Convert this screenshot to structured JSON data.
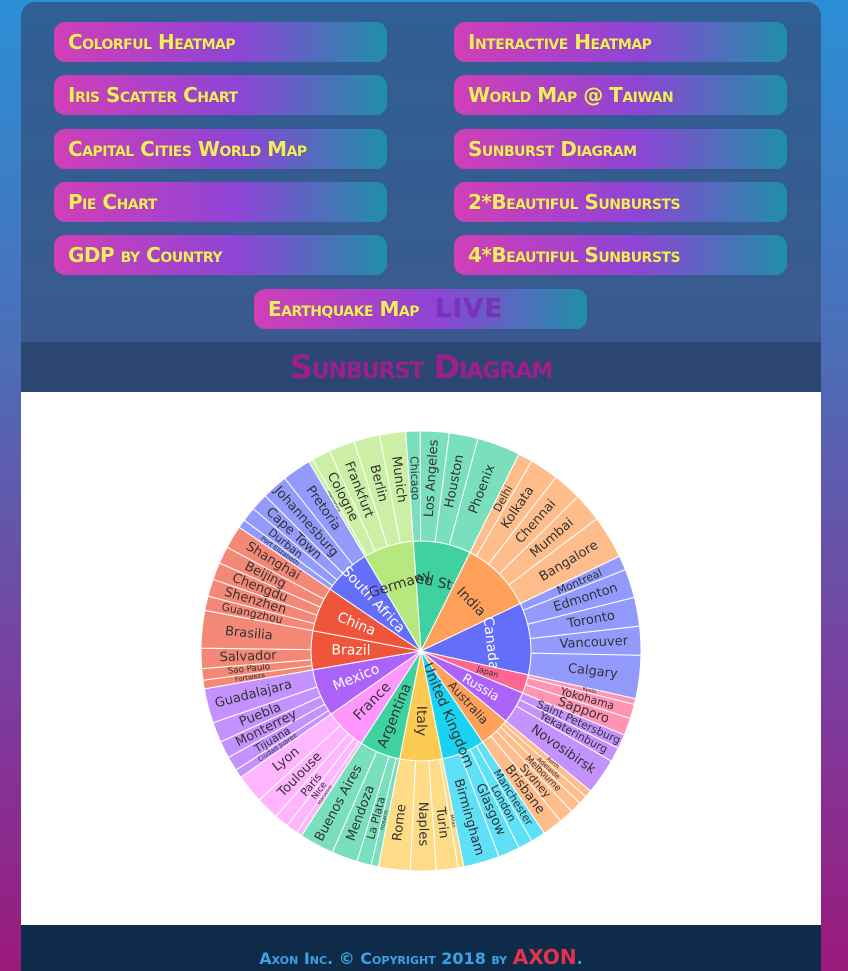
{
  "nav": [
    {
      "label": "Colorful Heatmap"
    },
    {
      "label": "Interactive Heatmap"
    },
    {
      "label": "Iris Scatter Chart"
    },
    {
      "label": "World Map @ Taiwan"
    },
    {
      "label": "Capital Cities World Map"
    },
    {
      "label": "Sunburst Diagram"
    },
    {
      "label": "Pie Chart"
    },
    {
      "label": "2*Beautiful Sunbursts"
    },
    {
      "label": "GDP by Country"
    },
    {
      "label": "4*Beautiful Sunbursts"
    }
  ],
  "earthquake": {
    "label": "Earthquake Map",
    "live": "LIVE"
  },
  "page_title": "Sunburst Diagram",
  "footer": {
    "text": "Axon Inc. © Copyright 2018 by ",
    "brand": "AXON",
    "end": "."
  },
  "chart_data": {
    "type": "sunburst",
    "countries": [
      {
        "name": "United States",
        "color": "#3fd1a0",
        "cities": [
          "Chicago",
          "Los Angeles",
          "Houston",
          "Phoenix"
        ],
        "w": [
          1,
          2,
          2,
          3
        ]
      },
      {
        "name": "India",
        "color": "#ffa15a",
        "cities": [
          "Delhi",
          "Kolkata",
          "Chennai",
          "Mumbai",
          "Bangalore"
        ],
        "w": [
          1,
          2,
          2,
          2,
          3
        ]
      },
      {
        "name": "Canada",
        "color": "#636efa",
        "cities": [
          "Montreal",
          "Edmonton",
          "Toronto",
          "Vancouver",
          "Calgary"
        ],
        "w": [
          1,
          2,
          2,
          2,
          3
        ]
      },
      {
        "name": "Japan",
        "color": "#ff6692",
        "cities": [
          "Kyoto",
          "Yokohama",
          "Sapporo"
        ],
        "w": [
          0.4,
          1,
          1.2
        ]
      },
      {
        "name": "Russia",
        "color": "#ab63fa",
        "cities": [
          "Saint Petersburg",
          "Yekaterinburg",
          "Novosibirsk"
        ],
        "w": [
          1,
          1,
          2.5
        ]
      },
      {
        "name": "Australia",
        "color": "#ffa15a",
        "cities": [
          "Perth",
          "Adelaide",
          "Melbourne",
          "Sydney",
          "Brisbane"
        ],
        "w": [
          0.5,
          0.6,
          0.8,
          1,
          1.4
        ]
      },
      {
        "name": "United Kingdom",
        "color": "#19d3f3",
        "cities": [
          "Manchester",
          "London",
          "Glasgow",
          "Birmingham"
        ],
        "w": [
          1,
          1,
          1.5,
          2.5
        ]
      },
      {
        "name": "Italy",
        "color": "#fecb52",
        "cities": [
          "Milan",
          "Turin",
          "Naples",
          "Rome"
        ],
        "w": [
          0.4,
          1.5,
          1.8,
          2.2
        ]
      },
      {
        "name": "Argentina",
        "color": "#3fd1a0",
        "cities": [
          "Rosario",
          "La Plata",
          "Mendoza",
          "Buenos Aires"
        ],
        "w": [
          0.5,
          1,
          1.8,
          2.4
        ]
      },
      {
        "name": "France",
        "color": "#ff97ff",
        "cities": [
          "Marseille",
          "Nice",
          "Paris",
          "Toulouse",
          "Lyon"
        ],
        "w": [
          0.4,
          0.8,
          1,
          1.6,
          2
        ]
      },
      {
        "name": "Mexico",
        "color": "#ab63fa",
        "cities": [
          "Ciudad Juárez",
          "Tijuana",
          "Monterrey",
          "Puebla",
          "Guadalajara"
        ],
        "w": [
          0.6,
          1,
          1.2,
          1.4,
          2.4
        ]
      },
      {
        "name": "Brazil",
        "color": "#ef553b",
        "cities": [
          "Fortaleza",
          "Sao Paulo",
          "Salvador",
          "Brasilia"
        ],
        "w": [
          0.6,
          0.8,
          1.4,
          2.6
        ]
      },
      {
        "name": "China",
        "color": "#ef553b",
        "cities": [
          "Guangzhou",
          "Shenzhen",
          "Chengdu",
          "Beijing",
          "Shanghai"
        ],
        "w": [
          1,
          1.2,
          1.2,
          1.2,
          1.6
        ]
      },
      {
        "name": "South Africa",
        "color": "#636efa",
        "cities": [
          "Port Elizabeth",
          "Durban",
          "Cape Town",
          "Johannesburg",
          "Pretoria"
        ],
        "w": [
          0.6,
          1,
          1.2,
          1.8,
          2
        ]
      },
      {
        "name": "Germany",
        "color": "#b6e880",
        "cities": [
          "Hamburg",
          "Cologne",
          "Frankfurt",
          "Berlin",
          "Munich"
        ],
        "w": [
          0.3,
          1.3,
          1.8,
          1.8,
          1.8
        ]
      }
    ]
  }
}
